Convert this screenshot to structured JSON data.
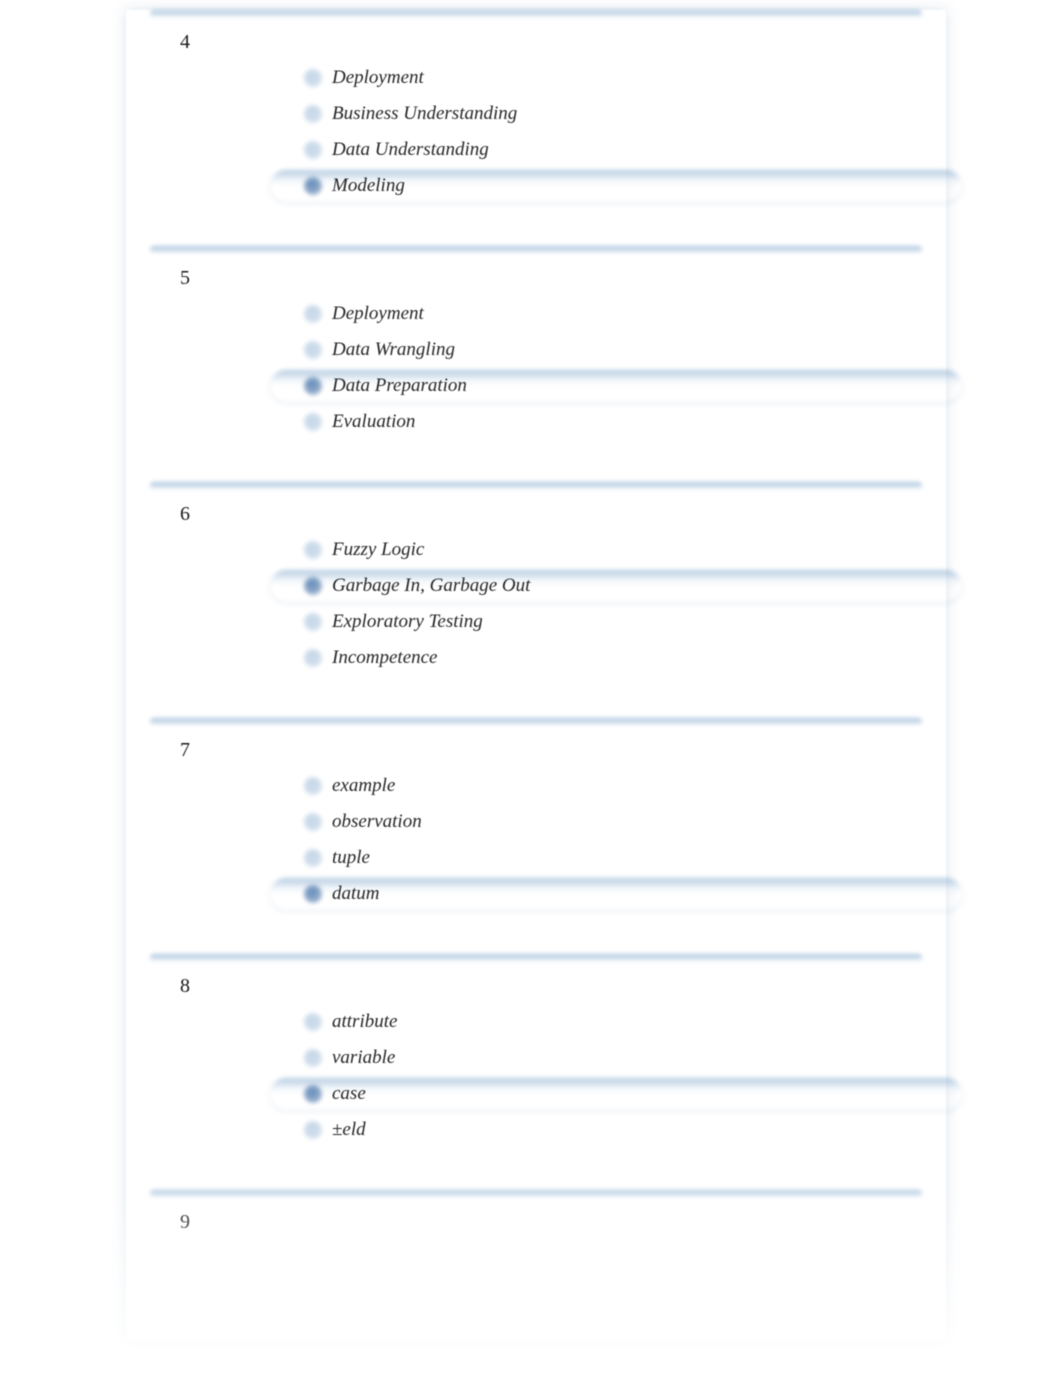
{
  "questions": [
    {
      "number": "4",
      "options": [
        {
          "label": "Deployment",
          "selected": false,
          "highlight": false
        },
        {
          "label": "Business Understanding",
          "selected": false,
          "highlight": false
        },
        {
          "label": "Data Understanding",
          "selected": false,
          "highlight": false
        },
        {
          "label": "Modeling",
          "selected": true,
          "highlight": true
        }
      ]
    },
    {
      "number": "5",
      "options": [
        {
          "label": "Deployment",
          "selected": false,
          "highlight": false
        },
        {
          "label": "Data Wrangling",
          "selected": false,
          "highlight": false
        },
        {
          "label": "Data Preparation",
          "selected": true,
          "highlight": true
        },
        {
          "label": "Evaluation",
          "selected": false,
          "highlight": false
        }
      ]
    },
    {
      "number": "6",
      "options": [
        {
          "label": "Fuzzy Logic",
          "selected": false,
          "highlight": false
        },
        {
          "label": "Garbage In, Garbage Out",
          "selected": true,
          "highlight": true
        },
        {
          "label": "Exploratory Testing",
          "selected": false,
          "highlight": false
        },
        {
          "label": "Incompetence",
          "selected": false,
          "highlight": false
        }
      ]
    },
    {
      "number": "7",
      "options": [
        {
          "label": "example",
          "selected": false,
          "highlight": false
        },
        {
          "label": "observation",
          "selected": false,
          "highlight": false
        },
        {
          "label": "tuple",
          "selected": false,
          "highlight": false
        },
        {
          "label": "datum",
          "selected": true,
          "highlight": true
        }
      ]
    },
    {
      "number": "8",
      "options": [
        {
          "label": "attribute",
          "selected": false,
          "highlight": false
        },
        {
          "label": "variable",
          "selected": false,
          "highlight": false
        },
        {
          "label": "case",
          "selected": true,
          "highlight": true
        },
        {
          "label": "±eld",
          "selected": false,
          "highlight": false
        }
      ]
    },
    {
      "number": "9",
      "options": []
    }
  ]
}
